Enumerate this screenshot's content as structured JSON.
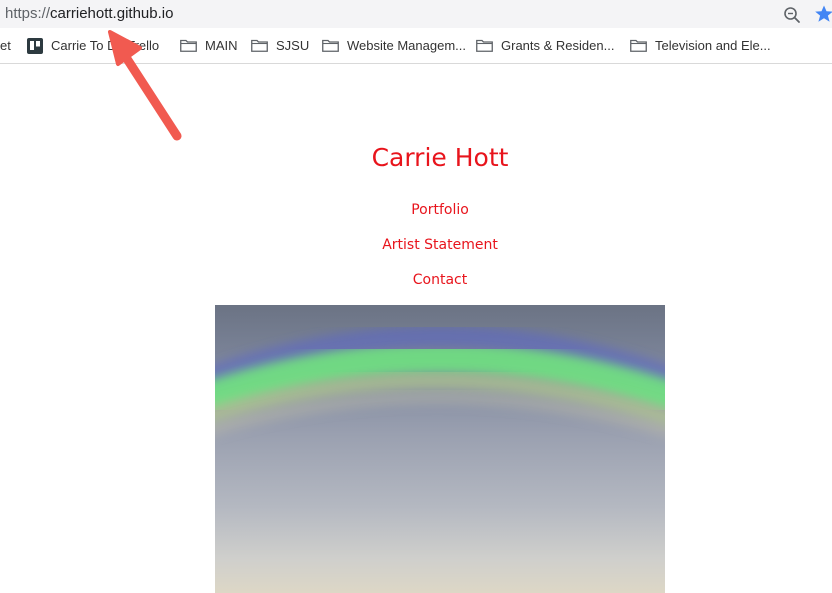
{
  "browser": {
    "url_scheme": "https://",
    "url_host": "carriehott.github.io"
  },
  "bookmarks": [
    {
      "label": "et",
      "icon": "none"
    },
    {
      "label": "Carrie To Do Trello",
      "icon": "trello-icon"
    },
    {
      "label": "MAIN",
      "icon": "folder-icon"
    },
    {
      "label": "SJSU",
      "icon": "folder-icon"
    },
    {
      "label": "Website Managem...",
      "icon": "folder-icon"
    },
    {
      "label": "Grants & Residen...",
      "icon": "folder-icon"
    },
    {
      "label": "Television and Ele...",
      "icon": "folder-icon"
    }
  ],
  "site": {
    "title": "Carrie Hott",
    "nav": [
      {
        "label": "Portfolio"
      },
      {
        "label": "Artist Statement"
      },
      {
        "label": "Contact"
      }
    ],
    "accent_color": "#e8141c"
  },
  "annotation": {
    "arrow_color": "#f15a50"
  }
}
